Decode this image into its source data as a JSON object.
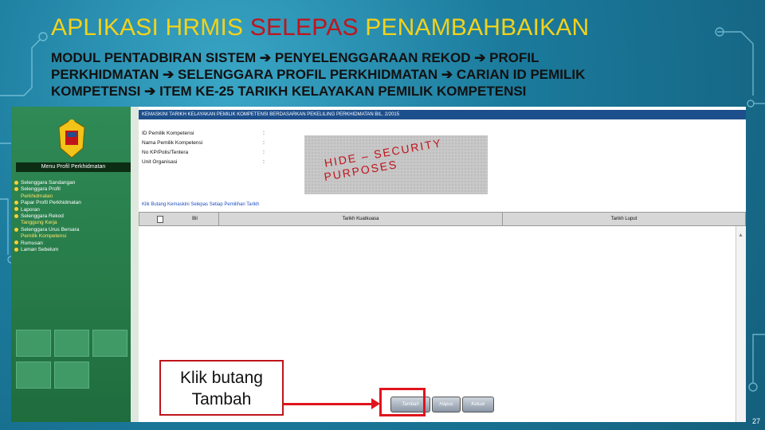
{
  "slide": {
    "title_part1": "APLIKASI HRMIS ",
    "title_part2": "SELEPAS",
    "title_part3": " PENAMBAHBAIKAN",
    "breadcrumb_line1": "MODUL PENTADBIRAN SISTEM ➔ PENYELENGGARAAN REKOD ➔ PROFIL",
    "breadcrumb_line2": "PERKHIDMATAN ➔ SELENGGARA PROFIL PERKHIDMATAN ➔ CARIAN ID PEMILIK",
    "breadcrumb_line3": "KOMPETENSI ➔ ITEM KE-25 TARIKH KELAYAKAN PEMILIK KOMPETENSI",
    "callout_line1": "Klik butang",
    "callout_line2": "Tambah",
    "page_number": "27"
  },
  "app": {
    "side_header": "Menu Profil Perkhidmatan",
    "menu": [
      {
        "label": "Selenggara Sandangan",
        "sub": false
      },
      {
        "label": "Selenggara Profil",
        "sub": false
      },
      {
        "label": "Perkhidmatan",
        "sub": true
      },
      {
        "label": "Papar Profil Perkhidmatan",
        "sub": false
      },
      {
        "label": "Laporan",
        "sub": false
      },
      {
        "label": "Selenggara Rekod",
        "sub": false
      },
      {
        "label": "Tanggung Kerja",
        "sub": true
      },
      {
        "label": "Selenggara Urus Bersara",
        "sub": false
      },
      {
        "label": "Pemilik Kompetensi",
        "sub": true
      },
      {
        "label": "Rumusan",
        "sub": false
      },
      {
        "label": "Laman Sebelum",
        "sub": false
      }
    ],
    "banner": "KEMASKINI TARIKH KELAYAKAN PEMILIK KOMPETENSI BERDASARKAN PEKELILING PERKHIDMATAN BIL. 2/2015",
    "fields": [
      "ID Pemilik Kompetensi",
      "Nama Pemilik Kompetensi",
      "No KP/Polis/Tentera",
      "Unit Organisasi"
    ],
    "hide_text1": "HIDE – SECURITY",
    "hide_text2": "PURPOSES",
    "link": "Klik Butang Kemaskini Selepas Setiap Pemilihan Tarikh",
    "columns": [
      "Bil",
      "Tarikh Kuatkuasa",
      "Tarikh Luput"
    ],
    "buttons": {
      "add": "Tambah",
      "delete": "Hapus",
      "exit": "Keluar"
    }
  }
}
